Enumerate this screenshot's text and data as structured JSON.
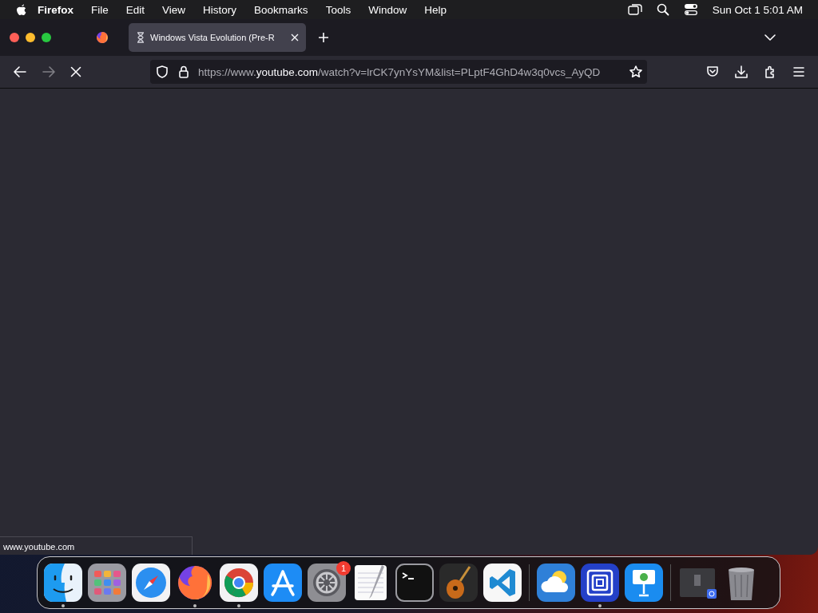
{
  "menu_bar": {
    "app": "Firefox",
    "items": [
      "File",
      "Edit",
      "View",
      "History",
      "Bookmarks",
      "Tools",
      "Window",
      "Help"
    ],
    "clock": "Sun Oct 1  5:01 AM"
  },
  "tabs": [
    {
      "kind": "pinned",
      "selected": false
    },
    {
      "kind": "page",
      "title": "Windows Vista Evolution (Pre-R",
      "loading": true,
      "selected": true
    }
  ],
  "toolbar": {
    "url": "https://www.**youtube.com**/watch?v=lrCK7ynYsYM&list=PLptF4GhD4w3q0vcs_AyQD",
    "forward_disabled": true,
    "loading": true
  },
  "status_link": "www.youtube.com",
  "dock": [
    {
      "kind": "finder",
      "running": true
    },
    {
      "kind": "launchpad",
      "running": false
    },
    {
      "kind": "safari",
      "running": false
    },
    {
      "kind": "firefox",
      "running": true
    },
    {
      "kind": "chrome",
      "running": true
    },
    {
      "kind": "appstore",
      "running": false
    },
    {
      "kind": "settings",
      "running": false,
      "badge": "1"
    },
    {
      "kind": "textedit",
      "running": false
    },
    {
      "kind": "terminal",
      "running": false
    },
    {
      "kind": "guitar",
      "running": false
    },
    {
      "kind": "vscode",
      "running": false
    },
    {
      "kind": "separator"
    },
    {
      "kind": "weather",
      "running": false
    },
    {
      "kind": "squares",
      "running": true
    },
    {
      "kind": "keynote",
      "running": false
    },
    {
      "kind": "separator"
    },
    {
      "kind": "window",
      "running": false
    },
    {
      "kind": "trash",
      "running": false
    }
  ]
}
